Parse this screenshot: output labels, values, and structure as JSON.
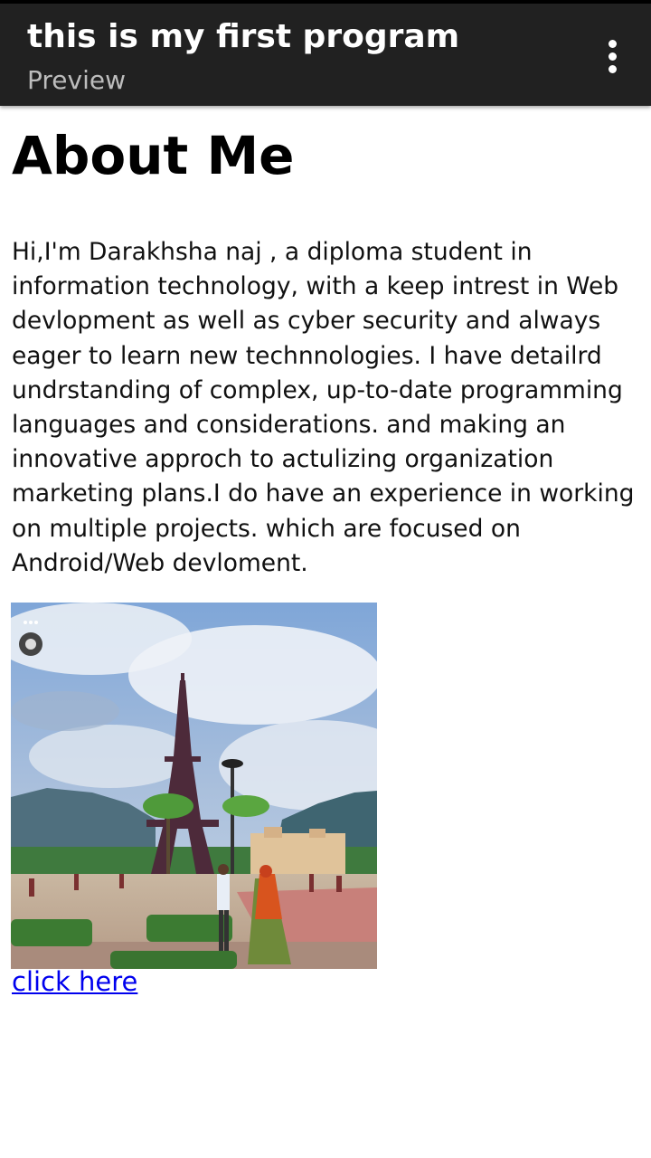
{
  "appbar": {
    "title": "this is my first program",
    "subtitle": "Preview",
    "menu_icon": "more-vertical-icon"
  },
  "page": {
    "heading": "About Me",
    "bio": "Hi,I'm Darakhsha naj , a diploma student in information technology, with a keep intrest in Web devlopment as well as cyber security and always eager to learn new technnologies. I have detailrd undrstanding of complex, up-to-date programming languages and considerations. and making an innovative approch to actulizing organization marketing plans.I do have an experience in working on multiple projects. which are focused on Android/Web devloment.",
    "link_text": "click here"
  },
  "colors": {
    "appbar_bg": "#212121",
    "link": "#0000ee",
    "text": "#111111"
  }
}
